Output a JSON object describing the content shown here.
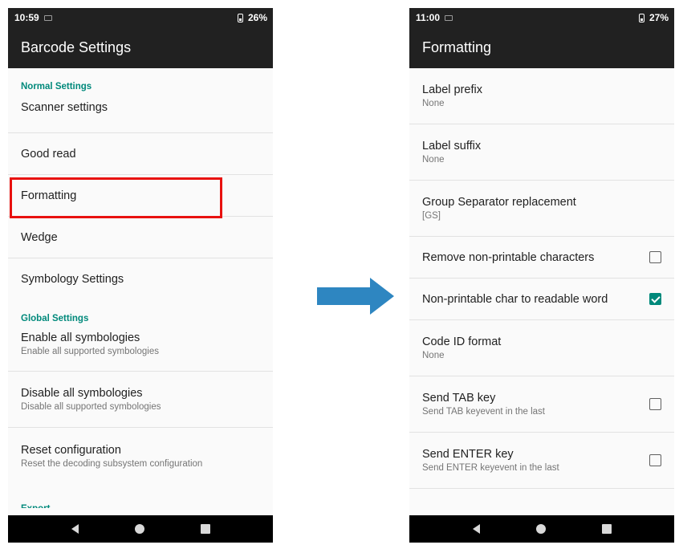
{
  "left_screen": {
    "status": {
      "time": "10:59",
      "battery": "26%"
    },
    "title": "Barcode Settings",
    "normal_category": "Normal Settings",
    "normal_items": [
      {
        "title": "Scanner settings"
      },
      {
        "title": "Good read"
      },
      {
        "title": "Formatting"
      },
      {
        "title": "Wedge"
      },
      {
        "title": "Symbology Settings"
      }
    ],
    "global_category": "Global Settings",
    "global_items": [
      {
        "title": "Enable all symbologies",
        "summary": "Enable all supported symbologies"
      },
      {
        "title": "Disable all symbologies",
        "summary": "Disable all supported symbologies"
      },
      {
        "title": "Reset configuration",
        "summary": "Reset the decoding subsystem configuration"
      }
    ],
    "export_category": "Export"
  },
  "right_screen": {
    "status": {
      "time": "11:00",
      "battery": "27%"
    },
    "title": "Formatting",
    "items": [
      {
        "title": "Label prefix",
        "summary": "None"
      },
      {
        "title": "Label suffix",
        "summary": "None"
      },
      {
        "title": "Group Separator replacement",
        "summary": "[GS]"
      },
      {
        "title": "Remove non-printable characters",
        "checked": false
      },
      {
        "title": "Non-printable char to readable word",
        "checked": true
      },
      {
        "title": "Code ID format",
        "summary": "None"
      },
      {
        "title": "Send TAB key",
        "summary": "Send TAB keyevent in the last",
        "checked": false
      },
      {
        "title": "Send ENTER key",
        "summary": "Send ENTER keyevent in the last",
        "checked": false
      }
    ]
  },
  "colors": {
    "accent": "#00897b",
    "appbar": "#212121",
    "highlight": "#e8110f",
    "arrow": "#2e86c1"
  },
  "icons": [
    "battery-icon",
    "notification-icon",
    "back-icon",
    "home-icon",
    "recents-icon",
    "right-arrow-icon"
  ]
}
